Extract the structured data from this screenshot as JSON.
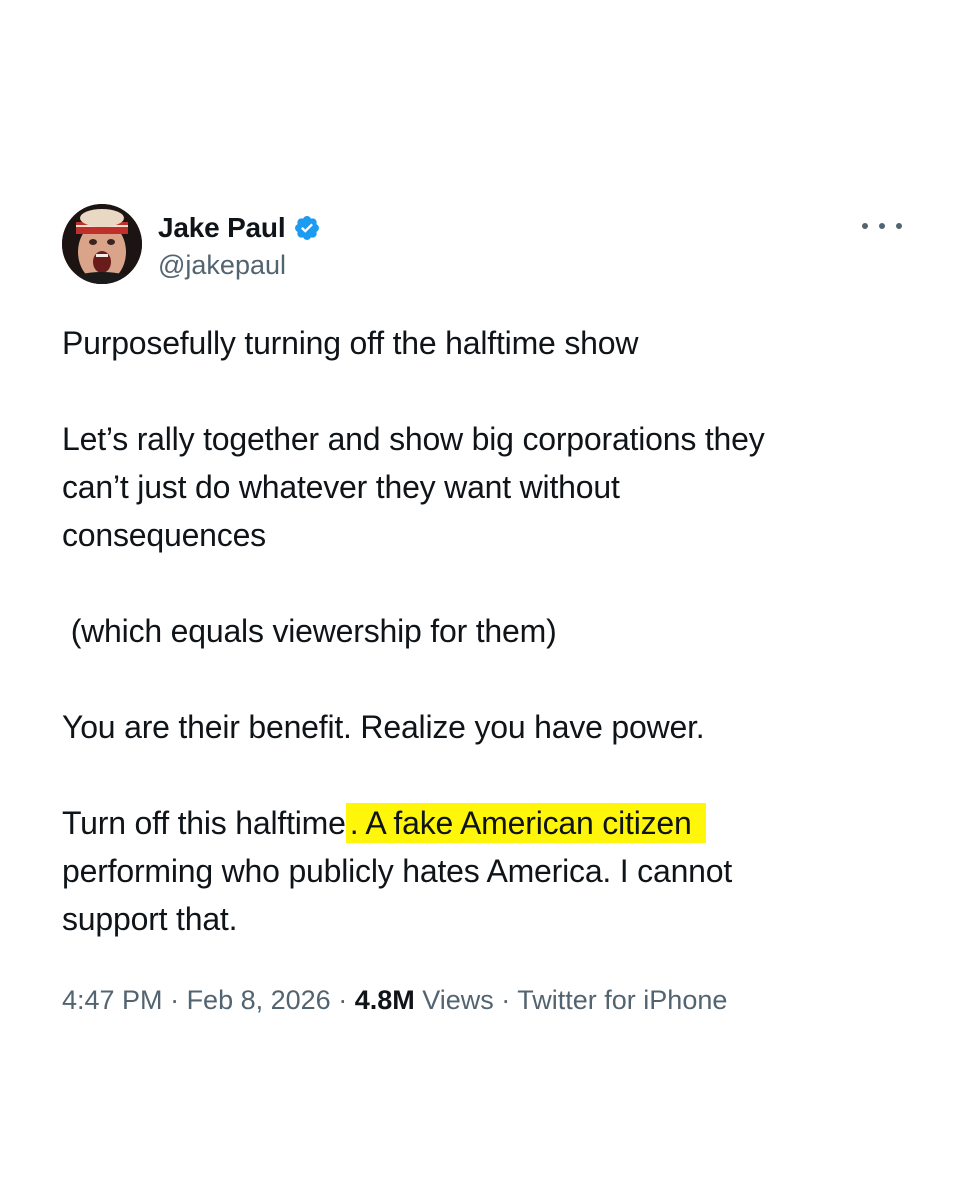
{
  "tweet": {
    "author": {
      "display_name": "Jake Paul",
      "handle": "@jakepaul",
      "verified": true
    },
    "text": {
      "line1": "Purposefully turning off the halftime show",
      "line2": "Let’s rally together and show big corporations they",
      "line3": "can’t just do whatever they want without",
      "line4": "consequences",
      "line5": " (which equals viewership for them)",
      "line6": "You are their benefit. Realize you have power.",
      "line7_before": "Turn off this halftime",
      "line7_period": ".",
      "line7_highlight": " A fake American citizen",
      "line8": "performing who publicly hates America. I cannot",
      "line9": "support that."
    },
    "meta": {
      "time": "4:47 PM",
      "sep1": " · ",
      "date": "Feb 8, 2026",
      "sep2": " · ",
      "views_count": "4.8M",
      "views_label": " Views",
      "sep3": " · ",
      "source": "Twitter for iPhone"
    }
  },
  "colors": {
    "text": "#0f1419",
    "secondary": "#536471",
    "verified": "#1d9bf0",
    "highlight": "#fff60a"
  },
  "icons": {
    "verified": "verified-badge-icon",
    "more": "more-options-icon"
  }
}
